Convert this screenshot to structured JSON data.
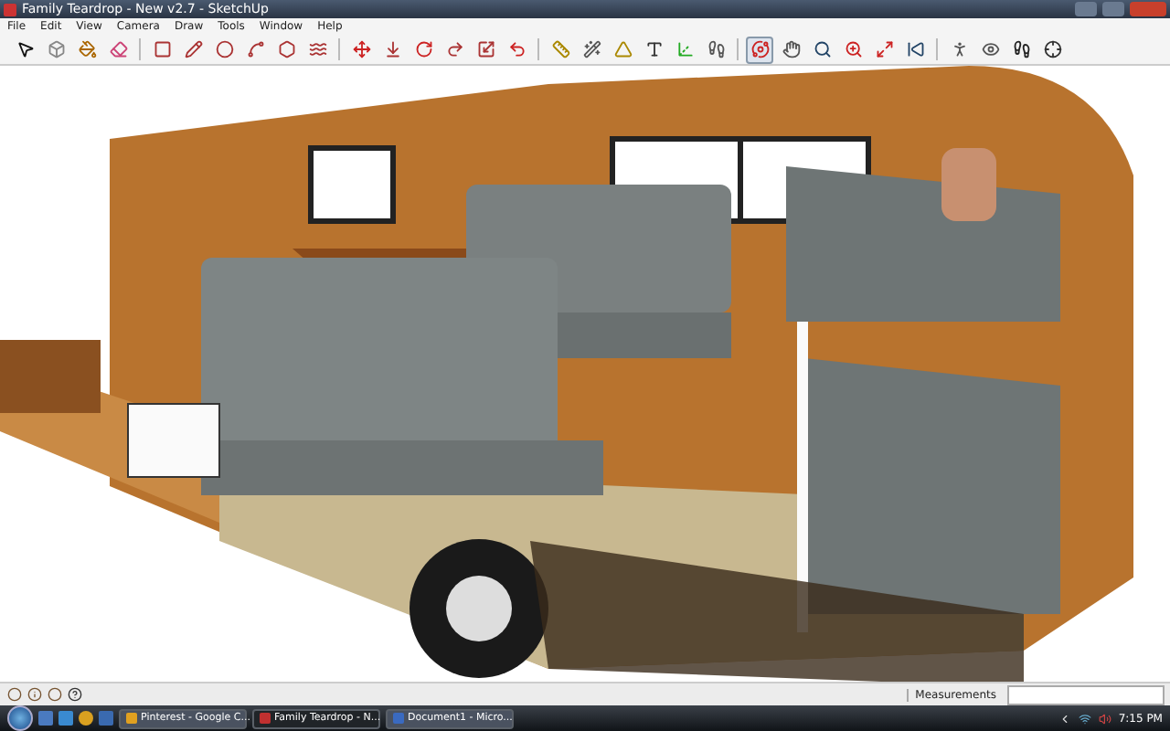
{
  "window": {
    "title": "Family Teardrop - New v2.7 - SketchUp"
  },
  "menu": [
    "File",
    "Edit",
    "View",
    "Camera",
    "Draw",
    "Tools",
    "Window",
    "Help"
  ],
  "status_bar": {
    "measurements_label": "Measurements"
  },
  "taskbar": {
    "tasks": [
      {
        "label": "Pinterest - Google C...",
        "selected": false
      },
      {
        "label": "Family Teardrop - N...",
        "selected": true
      },
      {
        "label": "Document1 - Micro...",
        "selected": false
      }
    ],
    "clock": "7:15 PM"
  }
}
